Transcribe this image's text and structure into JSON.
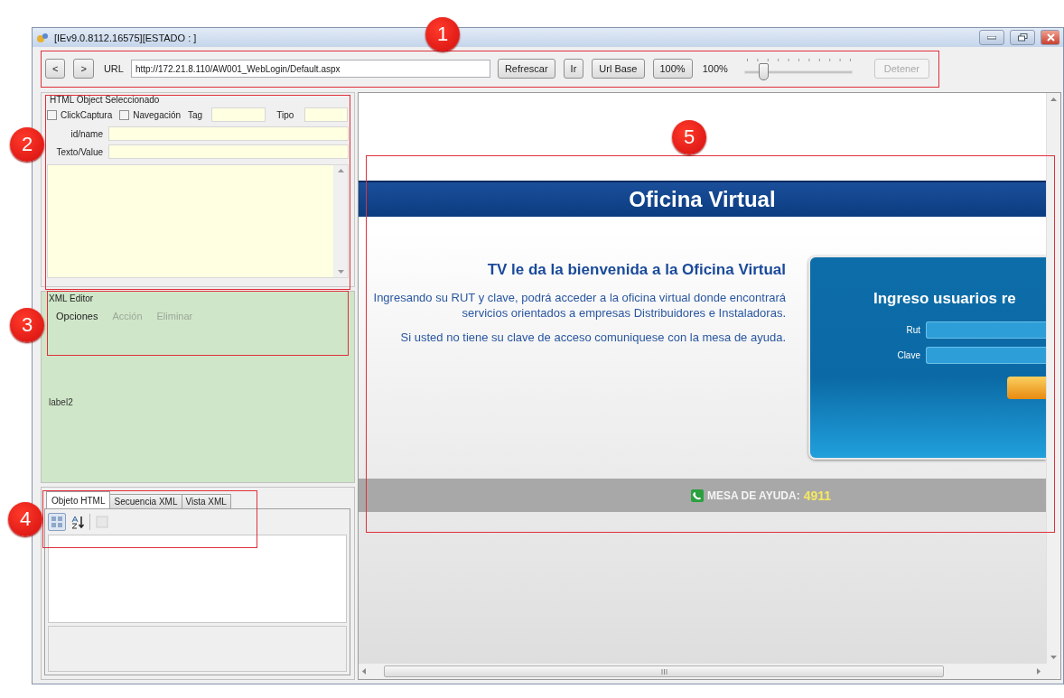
{
  "window": {
    "title": "[IEv9.0.8112.16575][ESTADO : ]"
  },
  "toolbar": [
    {
      "kind": "button",
      "label": "<",
      "disabled": false
    },
    {
      "kind": "button",
      "label": ">",
      "disabled": false
    },
    {
      "kind": "label",
      "text": "URL"
    },
    {
      "kind": "field",
      "value": "http://172.21.8.110/AW001_WebLogin/Default.aspx"
    },
    {
      "kind": "button",
      "label": "Refrescar",
      "disabled": false
    },
    {
      "kind": "button",
      "label": "Ir",
      "disabled": false
    },
    {
      "kind": "button",
      "label": "Url Base",
      "disabled": false
    },
    {
      "kind": "button",
      "label": "100%",
      "disabled": false
    },
    {
      "kind": "label",
      "text": "100%"
    },
    {
      "kind": "slider",
      "level": 0.17
    },
    {
      "kind": "button",
      "label": "Detener",
      "disabled": true
    }
  ],
  "html_object": {
    "title": "HTML Object Seleccionado",
    "checkboxes": [
      {
        "label": "ClickCaptura",
        "checked": false
      },
      {
        "label": "Navegación",
        "checked": false
      }
    ],
    "tag_label": "Tag",
    "tipo_label": "Tipo",
    "fields": [
      {
        "label": "id/name"
      },
      {
        "label": "Texto/Value"
      }
    ]
  },
  "xml_editor": {
    "title": "XML Editor",
    "menu": [
      {
        "label": "Opciones",
        "disabled": false
      },
      {
        "label": "Acción",
        "disabled": true
      },
      {
        "label": "Eliminar",
        "disabled": true
      }
    ],
    "label": "label2"
  },
  "tabs": [
    {
      "label": "Objeto HTML",
      "selected": true
    },
    {
      "label": "Secuencia XML",
      "selected": false
    },
    {
      "label": "Vista XML",
      "selected": false
    }
  ],
  "property_toolbar": [
    {
      "kind": "categorized",
      "selected": true,
      "disabled": false
    },
    {
      "kind": "alphabetical",
      "selected": false,
      "disabled": false
    },
    {
      "kind": "pages",
      "selected": false,
      "disabled": true
    }
  ],
  "browser": {
    "banner": "Oficina Virtual",
    "heading": "TV le da la bienvenida a la Oficina Virtual",
    "paragraphs": [
      "Ingresando su RUT y clave, podrá acceder a la oficina virtual donde encontrará servicios orientados a empresas Distribuidores e Instaladoras.",
      "Si usted no tiene su clave de acceso comuniquese con la mesa de ayuda."
    ],
    "login": {
      "title": "Ingreso usuarios re",
      "fields": [
        {
          "label": "Rut"
        },
        {
          "label": "Clave"
        }
      ]
    },
    "footer": {
      "label": "MESA DE AYUDA:",
      "number": "4911"
    }
  },
  "callouts": [
    {
      "number": "1"
    },
    {
      "number": "2"
    },
    {
      "number": "3"
    },
    {
      "number": "4"
    },
    {
      "number": "5"
    }
  ]
}
